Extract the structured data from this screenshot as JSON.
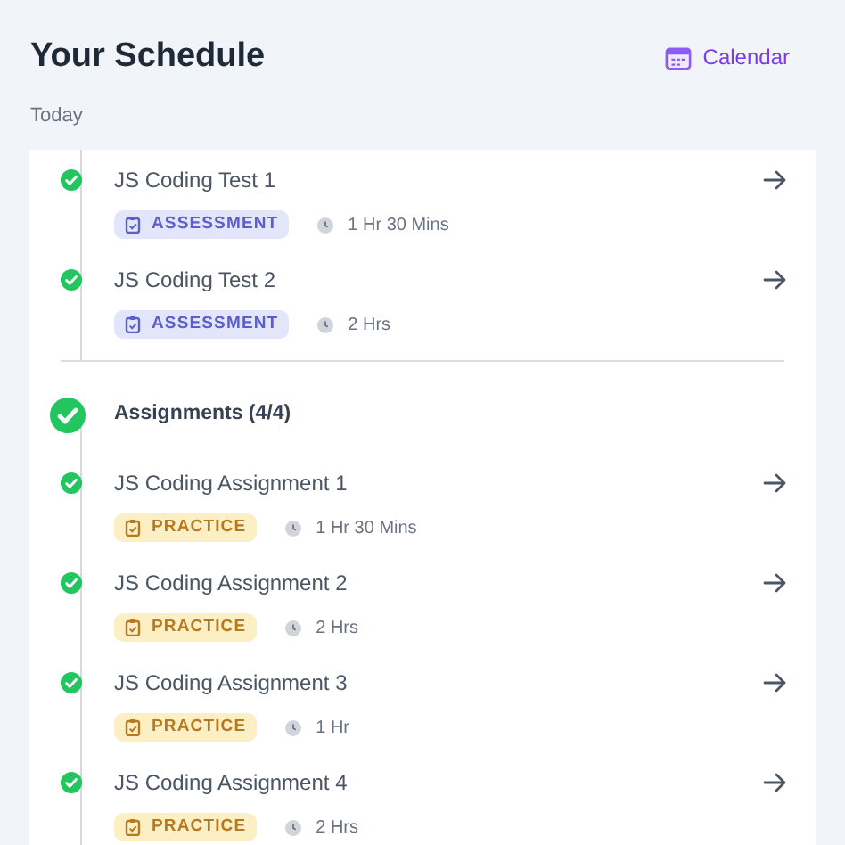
{
  "header": {
    "title": "Your Schedule",
    "calendar_link": "Calendar"
  },
  "subtitle": "Today",
  "sections": [
    {
      "items": [
        {
          "title": "JS Coding Test 1",
          "done": true,
          "tag": {
            "kind": "assessment",
            "label": "ASSESSMENT"
          },
          "duration": "1 Hr 30 Mins"
        },
        {
          "title": "JS Coding Test 2",
          "done": true,
          "tag": {
            "kind": "assessment",
            "label": "ASSESSMENT"
          },
          "duration": "2 Hrs"
        }
      ]
    },
    {
      "heading": {
        "label": "Assignments (4/4)",
        "done": true
      },
      "items": [
        {
          "title": "JS Coding Assignment 1",
          "done": true,
          "tag": {
            "kind": "practice",
            "label": "PRACTICE"
          },
          "duration": "1 Hr 30 Mins"
        },
        {
          "title": "JS Coding Assignment 2",
          "done": true,
          "tag": {
            "kind": "practice",
            "label": "PRACTICE"
          },
          "duration": "2 Hrs"
        },
        {
          "title": "JS Coding Assignment 3",
          "done": true,
          "tag": {
            "kind": "practice",
            "label": "PRACTICE"
          },
          "duration": "1 Hr"
        },
        {
          "title": "JS Coding Assignment 4",
          "done": true,
          "tag": {
            "kind": "practice",
            "label": "PRACTICE"
          },
          "duration": "2 Hrs"
        }
      ]
    }
  ]
}
